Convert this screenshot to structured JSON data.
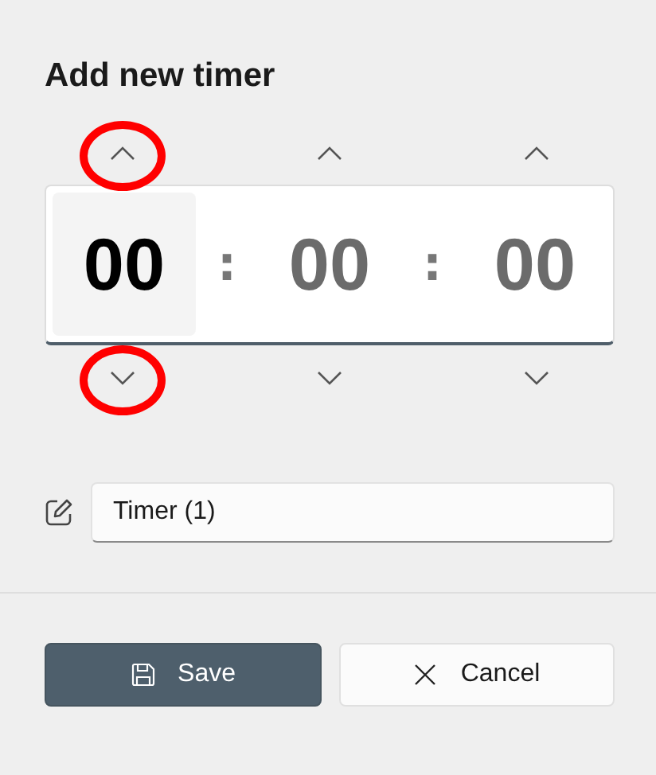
{
  "title": "Add new timer",
  "units": [
    {
      "value": "00",
      "selected": true,
      "circled": true
    },
    {
      "value": "00",
      "selected": false,
      "circled": false
    },
    {
      "value": "00",
      "selected": false,
      "circled": false
    }
  ],
  "separators": [
    ":",
    ":"
  ],
  "name_field": {
    "value": "Timer (1)"
  },
  "buttons": [
    {
      "kind": "save",
      "label": "Save"
    },
    {
      "kind": "cancel",
      "label": "Cancel"
    }
  ]
}
